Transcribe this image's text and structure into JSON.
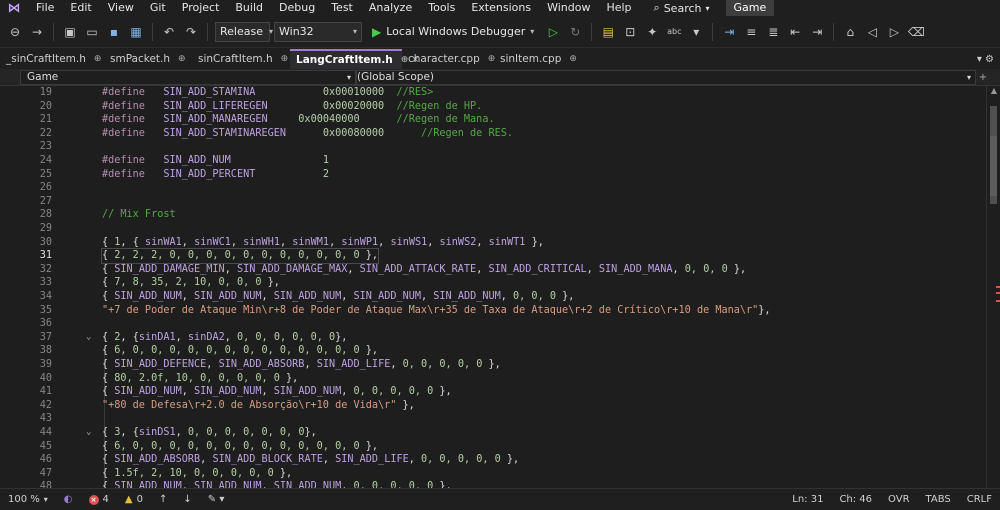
{
  "menu": {
    "items": [
      "File",
      "Edit",
      "View",
      "Git",
      "Project",
      "Build",
      "Debug",
      "Test",
      "Analyze",
      "Tools",
      "Extensions",
      "Window",
      "Help"
    ],
    "search_label": "Search",
    "solution_name": "Game"
  },
  "toolbar": {
    "configuration": "Release",
    "platform": "Win32",
    "debugger_label": "Local Windows Debugger"
  },
  "tabs": [
    {
      "label": "_sinCraftItem.h",
      "active": false
    },
    {
      "label": "smPacket.h",
      "active": false
    },
    {
      "label": "sinCraftItem.h",
      "active": false
    },
    {
      "label": "LangCraftItem.h",
      "active": true
    },
    {
      "label": "character.cpp",
      "active": false
    },
    {
      "label": "sinItem.cpp",
      "active": false
    }
  ],
  "navbar": {
    "project": "Game",
    "scope": "(Global Scope)"
  },
  "editor": {
    "current_line": 31,
    "lines": [
      {
        "n": 19,
        "tokens": [
          [
            "kw",
            "#define"
          ],
          [
            "plain",
            "   "
          ],
          [
            "macro",
            "SIN_ADD_STAMINA"
          ],
          [
            "plain",
            "           "
          ],
          [
            "num",
            "0x00010000"
          ],
          [
            "plain",
            "  "
          ],
          [
            "cmt",
            "//RES>"
          ]
        ]
      },
      {
        "n": 20,
        "tokens": [
          [
            "kw",
            "#define"
          ],
          [
            "plain",
            "   "
          ],
          [
            "macro",
            "SIN_ADD_LIFEREGEN"
          ],
          [
            "plain",
            "         "
          ],
          [
            "num",
            "0x00020000"
          ],
          [
            "plain",
            "  "
          ],
          [
            "cmt",
            "//Regen de HP."
          ]
        ]
      },
      {
        "n": 21,
        "tokens": [
          [
            "kw",
            "#define"
          ],
          [
            "plain",
            "   "
          ],
          [
            "macro",
            "SIN_ADD_MANAREGEN"
          ],
          [
            "plain",
            "     "
          ],
          [
            "num",
            "0x00040000"
          ],
          [
            "plain",
            "      "
          ],
          [
            "cmt",
            "//Regen de Mana."
          ]
        ]
      },
      {
        "n": 22,
        "tokens": [
          [
            "kw",
            "#define"
          ],
          [
            "plain",
            "   "
          ],
          [
            "macro",
            "SIN_ADD_STAMINAREGEN"
          ],
          [
            "plain",
            "      "
          ],
          [
            "num",
            "0x00080000"
          ],
          [
            "plain",
            "      "
          ],
          [
            "cmt",
            "//Regen de RES."
          ]
        ]
      },
      {
        "n": 23,
        "tokens": []
      },
      {
        "n": 24,
        "tokens": [
          [
            "kw",
            "#define"
          ],
          [
            "plain",
            "   "
          ],
          [
            "macro",
            "SIN_ADD_NUM"
          ],
          [
            "plain",
            "               "
          ],
          [
            "num",
            "1"
          ]
        ]
      },
      {
        "n": 25,
        "tokens": [
          [
            "kw",
            "#define"
          ],
          [
            "plain",
            "   "
          ],
          [
            "macro",
            "SIN_ADD_PERCENT"
          ],
          [
            "plain",
            "           "
          ],
          [
            "num",
            "2"
          ]
        ]
      },
      {
        "n": 26,
        "tokens": []
      },
      {
        "n": 27,
        "tokens": []
      },
      {
        "n": 28,
        "tokens": [
          [
            "cmt",
            "// Mix Frost"
          ]
        ]
      },
      {
        "n": 29,
        "tokens": []
      },
      {
        "n": 30,
        "tokens": [
          [
            "plain",
            "{ "
          ],
          [
            "num",
            "1"
          ],
          [
            "plain",
            ", { "
          ],
          [
            "macro",
            "sinWA1"
          ],
          [
            "plain",
            ", "
          ],
          [
            "macro",
            "sinWC1"
          ],
          [
            "plain",
            ", "
          ],
          [
            "macro",
            "sinWH1"
          ],
          [
            "plain",
            ", "
          ],
          [
            "macro",
            "sinWM1"
          ],
          [
            "plain",
            ", "
          ],
          [
            "macro",
            "sinWP1"
          ],
          [
            "plain",
            ", "
          ],
          [
            "macro",
            "sinWS1"
          ],
          [
            "plain",
            ", "
          ],
          [
            "macro",
            "sinWS2"
          ],
          [
            "plain",
            ", "
          ],
          [
            "macro",
            "sinWT1"
          ],
          [
            "plain",
            " },"
          ]
        ]
      },
      {
        "n": 31,
        "tokens": [
          [
            "plain",
            "{ "
          ],
          [
            "num",
            "2, 2, 2, 0, 0, 0, 0, 0, 0, 0, 0, 0, 0, 0"
          ],
          [
            "plain",
            " },"
          ]
        ]
      },
      {
        "n": 32,
        "tokens": [
          [
            "plain",
            "{ "
          ],
          [
            "macro",
            "SIN_ADD_DAMAGE_MIN"
          ],
          [
            "plain",
            ", "
          ],
          [
            "macro",
            "SIN_ADD_DAMAGE_MAX"
          ],
          [
            "plain",
            ", "
          ],
          [
            "macro",
            "SIN_ADD_ATTACK_RATE"
          ],
          [
            "plain",
            ", "
          ],
          [
            "macro",
            "SIN_ADD_CRITICAL"
          ],
          [
            "plain",
            ", "
          ],
          [
            "macro",
            "SIN_ADD_MANA"
          ],
          [
            "plain",
            ", "
          ],
          [
            "num",
            "0, 0, 0"
          ],
          [
            "plain",
            " },"
          ]
        ]
      },
      {
        "n": 33,
        "tokens": [
          [
            "plain",
            "{ "
          ],
          [
            "num",
            "7, 8, 35, 2, 10, 0, 0, 0"
          ],
          [
            "plain",
            " },"
          ]
        ]
      },
      {
        "n": 34,
        "tokens": [
          [
            "plain",
            "{ "
          ],
          [
            "macro",
            "SIN_ADD_NUM"
          ],
          [
            "plain",
            ", "
          ],
          [
            "macro",
            "SIN_ADD_NUM"
          ],
          [
            "plain",
            ", "
          ],
          [
            "macro",
            "SIN_ADD_NUM"
          ],
          [
            "plain",
            ", "
          ],
          [
            "macro",
            "SIN_ADD_NUM"
          ],
          [
            "plain",
            ", "
          ],
          [
            "macro",
            "SIN_ADD_NUM"
          ],
          [
            "plain",
            ", "
          ],
          [
            "num",
            "0, 0, 0"
          ],
          [
            "plain",
            " },"
          ]
        ]
      },
      {
        "n": 35,
        "tokens": [
          [
            "str",
            "\"+7 de Poder de Ataque Min\\r+8 de Poder de Ataque Max\\r+35 de Taxa de Ataque\\r+2 de Crítico\\r+10 de Mana\\r\""
          ],
          [
            "plain",
            "},"
          ]
        ]
      },
      {
        "n": 36,
        "tokens": []
      },
      {
        "n": 37,
        "tokens": [
          [
            "plain",
            "{ "
          ],
          [
            "num",
            "2"
          ],
          [
            "plain",
            ", {"
          ],
          [
            "macro",
            "sinDA1"
          ],
          [
            "plain",
            ", "
          ],
          [
            "macro",
            "sinDA2"
          ],
          [
            "plain",
            ", "
          ],
          [
            "num",
            "0, 0, 0, 0, 0, 0"
          ],
          [
            "plain",
            "},"
          ]
        ]
      },
      {
        "n": 38,
        "tokens": [
          [
            "plain",
            "{ "
          ],
          [
            "num",
            "6, 0, 0, 0, 0, 0, 0, 0, 0, 0, 0, 0, 0, 0"
          ],
          [
            "plain",
            " },"
          ]
        ]
      },
      {
        "n": 39,
        "tokens": [
          [
            "plain",
            "{ "
          ],
          [
            "macro",
            "SIN_ADD_DEFENCE"
          ],
          [
            "plain",
            ", "
          ],
          [
            "macro",
            "SIN_ADD_ABSORB"
          ],
          [
            "plain",
            ", "
          ],
          [
            "macro",
            "SIN_ADD_LIFE"
          ],
          [
            "plain",
            ", "
          ],
          [
            "num",
            "0, 0, 0, 0, 0"
          ],
          [
            "plain",
            " },"
          ]
        ]
      },
      {
        "n": 40,
        "tokens": [
          [
            "plain",
            "{ "
          ],
          [
            "num",
            "80, 2.0f, 10, 0, 0, 0, 0, 0"
          ],
          [
            "plain",
            " },"
          ]
        ]
      },
      {
        "n": 41,
        "tokens": [
          [
            "plain",
            "{ "
          ],
          [
            "macro",
            "SIN_ADD_NUM"
          ],
          [
            "plain",
            ", "
          ],
          [
            "macro",
            "SIN_ADD_NUM"
          ],
          [
            "plain",
            ", "
          ],
          [
            "macro",
            "SIN_ADD_NUM"
          ],
          [
            "plain",
            ", "
          ],
          [
            "num",
            "0, 0, 0, 0, 0"
          ],
          [
            "plain",
            " },"
          ]
        ]
      },
      {
        "n": 42,
        "tokens": [
          [
            "str",
            "\"+80 de Defesa\\r+2.0 de Absorção\\r+10 de Vida\\r\""
          ],
          [
            "plain",
            " },"
          ]
        ]
      },
      {
        "n": 43,
        "tokens": []
      },
      {
        "n": 44,
        "tokens": [
          [
            "plain",
            "{ "
          ],
          [
            "num",
            "3"
          ],
          [
            "plain",
            ", {"
          ],
          [
            "macro",
            "sinDS1"
          ],
          [
            "plain",
            ", "
          ],
          [
            "num",
            "0, 0, 0, 0, 0, 0, 0"
          ],
          [
            "plain",
            "},"
          ]
        ]
      },
      {
        "n": 45,
        "tokens": [
          [
            "plain",
            "{ "
          ],
          [
            "num",
            "6, 0, 0, 0, 0, 0, 0, 0, 0, 0, 0, 0, 0, 0"
          ],
          [
            "plain",
            " },"
          ]
        ]
      },
      {
        "n": 46,
        "tokens": [
          [
            "plain",
            "{ "
          ],
          [
            "macro",
            "SIN_ADD_ABSORB"
          ],
          [
            "plain",
            ", "
          ],
          [
            "macro",
            "SIN_ADD_BLOCK_RATE"
          ],
          [
            "plain",
            ", "
          ],
          [
            "macro",
            "SIN_ADD_LIFE"
          ],
          [
            "plain",
            ", "
          ],
          [
            "num",
            "0, 0, 0, 0, 0"
          ],
          [
            "plain",
            " },"
          ]
        ]
      },
      {
        "n": 47,
        "tokens": [
          [
            "plain",
            "{ "
          ],
          [
            "num",
            "1.5f, 2, 10, 0, 0, 0, 0, 0"
          ],
          [
            "plain",
            " },"
          ]
        ]
      },
      {
        "n": 48,
        "tokens": [
          [
            "plain",
            "{ "
          ],
          [
            "macro",
            "SIN_ADD_NUM"
          ],
          [
            "plain",
            ", "
          ],
          [
            "macro",
            "SIN_ADD_NUM"
          ],
          [
            "plain",
            ", "
          ],
          [
            "macro",
            "SIN_ADD_NUM"
          ],
          [
            "plain",
            ", "
          ],
          [
            "num",
            "0, 0, 0, 0, 0"
          ],
          [
            "plain",
            " },"
          ]
        ]
      }
    ]
  },
  "status": {
    "zoom": "100 %",
    "errors": "4",
    "warnings": "0",
    "line": "Ln: 31",
    "char": "Ch: 46",
    "overwrite": "OVR",
    "indent": "TABS",
    "line_ending": "CRLF"
  },
  "colors": {
    "accent": "#9e7bd6",
    "error": "#e05050",
    "run": "#4ec94e"
  }
}
